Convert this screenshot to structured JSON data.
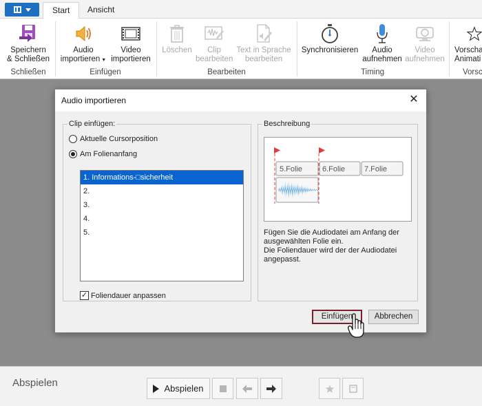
{
  "tabs": {
    "start": "Start",
    "view": "Ansicht"
  },
  "ribbon": {
    "save_close": [
      "Speichern",
      "& Schließen"
    ],
    "group_close": "Schließen",
    "audio_import": [
      "Audio",
      "importieren"
    ],
    "video_import": [
      "Video",
      "importieren"
    ],
    "group_insert": "Einfügen",
    "delete": "Löschen",
    "clip_edit": [
      "Clip",
      "bearbeiten"
    ],
    "tts_edit": [
      "Text in Sprache",
      "bearbeiten"
    ],
    "group_edit": "Bearbeiten",
    "sync": "Synchronisieren",
    "audio_record": [
      "Audio",
      "aufnehmen"
    ],
    "video_record": [
      "Video",
      "aufnehmen"
    ],
    "group_timing": "Timing",
    "preview_cut": [
      "Vorscha",
      "Animati"
    ],
    "group_preview_cut": "Vorscl"
  },
  "dialog": {
    "title": "Audio importieren",
    "clip_group": "Clip einfügen:",
    "radio_cursor": "Aktuelle Cursorposition",
    "radio_slide_start": "Am Folienanfang",
    "slides": [
      "1. Informations-□sicherheit",
      "2.",
      "3.",
      "4.",
      "5."
    ],
    "selected_slide_index": 0,
    "adjust_duration": "Foliendauer anpassen",
    "adjust_duration_checked": true,
    "description_group": "Beschreibung",
    "preview_slides": [
      "5.Folie",
      "6.Folie",
      "7.Folie"
    ],
    "description": [
      "Fügen Sie die Audiodatei am Anfang der",
      "ausgewählten Folie ein.",
      "Die Foliendauer wird der der Audiodatei",
      "angepasst."
    ],
    "insert_button": "Einfügen",
    "cancel_button": "Abbrechen"
  },
  "bottom": {
    "label": "Abspielen",
    "play_button": "Abspielen"
  },
  "colors": {
    "accent": "#1e6fc0",
    "selection": "#0a64d0",
    "default_button_border": "#7b1f2f",
    "marker": "#e0393e",
    "waveform": "#2a8fd8"
  }
}
